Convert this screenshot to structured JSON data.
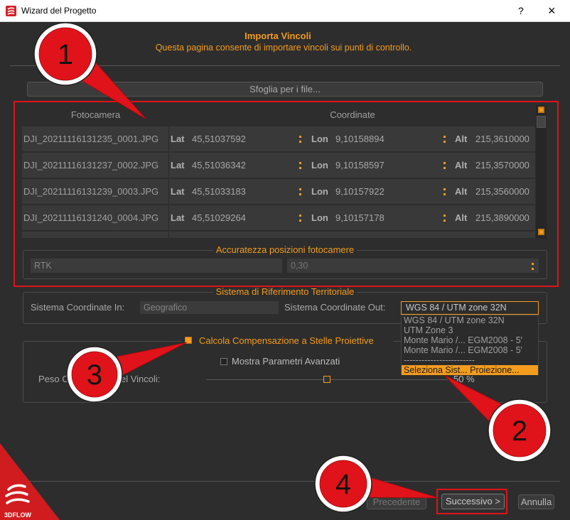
{
  "window": {
    "title": "Wizard del Progetto",
    "help_label": "?",
    "close_label": "×"
  },
  "header": {
    "title": "Importa Vincoli",
    "subtitle": "Questa pagina consente di importare vincoli sui punti di controllo."
  },
  "browse": {
    "label": "Sfoglia per i file..."
  },
  "table": {
    "columns": {
      "camera": "Fotocamera",
      "coordinates": "Coordinate"
    },
    "labels": {
      "lat": "Lat",
      "lon": "Lon",
      "alt": "Alt"
    },
    "rows": [
      {
        "file": "DJI_20211116131235_0001.JPG",
        "lat": "45,51037592",
        "lon": "9,10158894",
        "alt": "215,3610000"
      },
      {
        "file": "DJI_20211116131237_0002.JPG",
        "lat": "45,51036342",
        "lon": "9,10158597",
        "alt": "215,3570000"
      },
      {
        "file": "DJI_20211116131239_0003.JPG",
        "lat": "45,51033183",
        "lon": "9,10157922",
        "alt": "215,3560000"
      },
      {
        "file": "DJI_20211116131240_0004.JPG",
        "lat": "45,51029264",
        "lon": "9,10157178",
        "alt": "215,3890000"
      }
    ]
  },
  "accuracy": {
    "title": "Accuratezza posizioni fotocamere",
    "type": "RTK",
    "value": "0,30"
  },
  "crs": {
    "title": "Sistema di Riferimento Territoriale",
    "in_label": "Sistema Coordinate In:",
    "in_value": "Geografico",
    "out_label": "Sistema Coordinate Out:",
    "out_value": "WGS 84 / UTM zone 32N",
    "options": [
      "WGS 84 / UTM zone 32N",
      "UTM Zone 3",
      "Monte Mario /... EGM2008 - 5'",
      "Monte Mario /... EGM2008 - 5'",
      "------------------------",
      "Seleziona Sist... Proiezione..."
    ],
    "highlighted_index": 5
  },
  "compensation": {
    "label": "Calcola Compensazione a Stelle Proiettive",
    "checked": true,
    "advanced_label": "Mostra Parametri Avanzati",
    "advanced_checked": false,
    "weight_label_start": "Peso C",
    "weight_label_end": "el Vincoli:",
    "weight_value": 50,
    "weight_display": "50 %"
  },
  "footer": {
    "prev_label": "Precedente",
    "next_label": "Successivo >",
    "cancel_label": "Annulla"
  },
  "brand": {
    "logo_text": "3DFLOW"
  },
  "callouts": [
    "1",
    "2",
    "3",
    "4"
  ],
  "colors": {
    "accent": "#f39c1e",
    "annotation": "#e0131a",
    "background": "#2d2d2d"
  }
}
